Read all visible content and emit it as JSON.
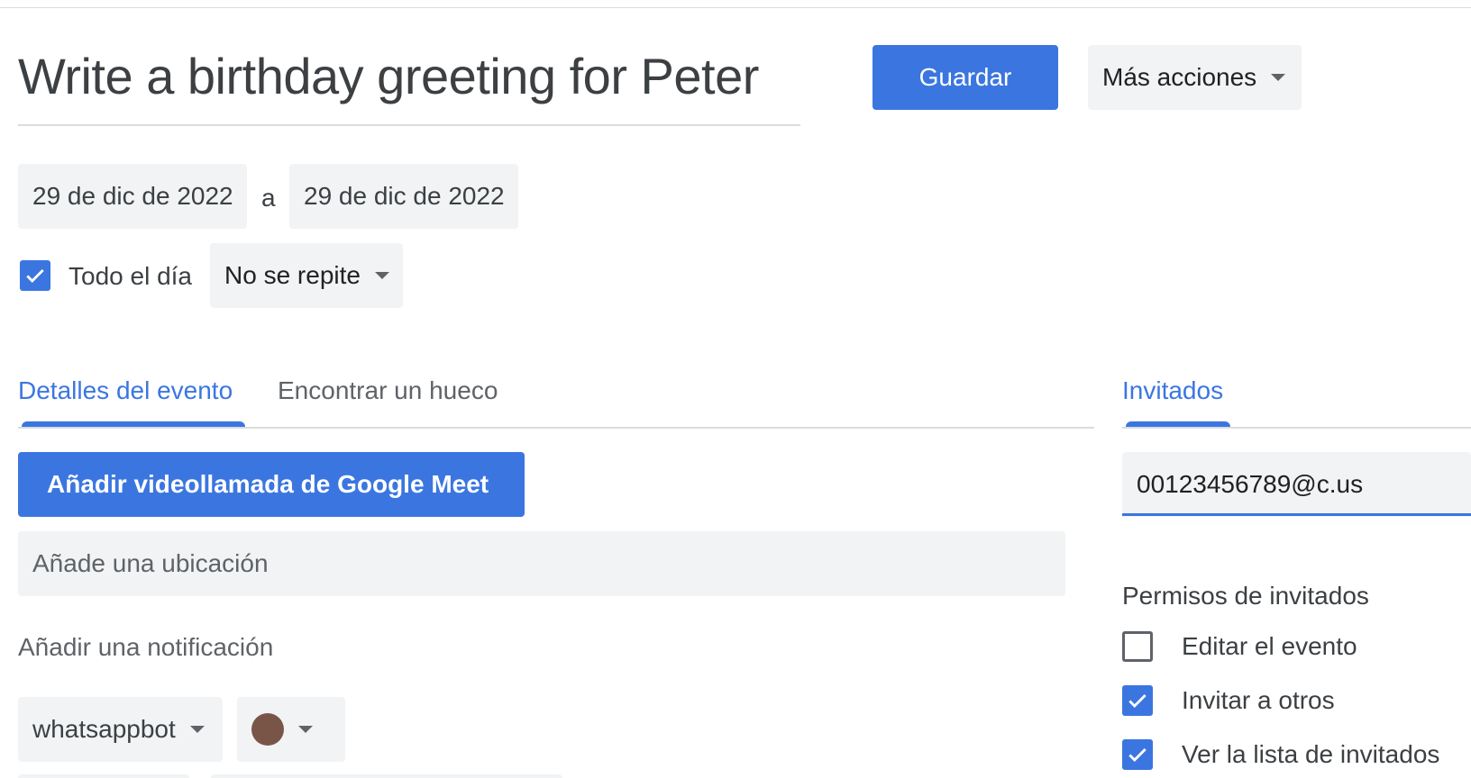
{
  "event": {
    "title": "Write a birthday greeting for Peter",
    "start_date": "29 de dic de 2022",
    "date_separator": "a",
    "end_date": "29 de dic de 2022",
    "all_day_label": "Todo el día",
    "all_day_checked": true,
    "repeat_value": "No se repite"
  },
  "toolbar": {
    "save_label": "Guardar",
    "more_actions_label": "Más acciones"
  },
  "tabs": {
    "details": "Detalles del evento",
    "find_time": "Encontrar un hueco",
    "guests": "Invitados"
  },
  "details": {
    "meet_button": "Añadir videollamada de Google Meet",
    "location_placeholder": "Añade una ubicación",
    "add_notification": "Añadir una notificación",
    "calendar": "whatsappbot",
    "event_color": "#795548"
  },
  "guests": {
    "input_value": "00123456789@c.us",
    "permissions_heading": "Permisos de invitados",
    "permissions": [
      {
        "label": "Editar el evento",
        "checked": false
      },
      {
        "label": "Invitar a otros",
        "checked": true
      },
      {
        "label": "Ver la lista de invitados",
        "checked": true
      }
    ]
  },
  "colors": {
    "accent": "#3b76e0",
    "chip_bg": "#f1f3f4"
  }
}
